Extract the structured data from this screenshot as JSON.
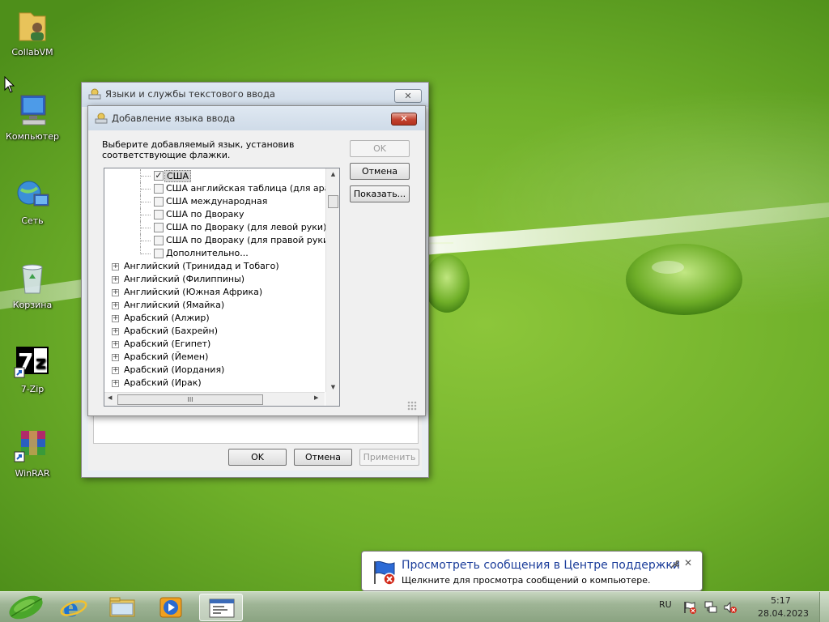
{
  "desktop": {
    "icons": [
      {
        "label": "CollabVM",
        "icon": "user-folder-icon"
      },
      {
        "label": "Компьютер",
        "icon": "computer-icon"
      },
      {
        "label": "Сеть",
        "icon": "network-icon"
      },
      {
        "label": "Корзина",
        "icon": "recycle-bin-icon"
      },
      {
        "label": "7-Zip",
        "icon": "7zip-icon"
      },
      {
        "label": "WinRAR",
        "icon": "winrar-icon"
      }
    ]
  },
  "outer_window": {
    "title": "Языки и службы текстового ввода",
    "close": "✕",
    "ok_label": "OK",
    "cancel_label": "Отмена",
    "apply_label": "Применить"
  },
  "add_dialog": {
    "title": "Добавление языка ввода",
    "close": "✕",
    "instruction": "Выберите добавляемый язык, установив соответствующие флажки.",
    "ok_label": "OK",
    "cancel_label": "Отмена",
    "show_label": "Показать...",
    "tree": {
      "sub_items": [
        {
          "label": "США",
          "checked": true,
          "selected": true
        },
        {
          "label": "США английская таблица (для арабской клавиатуры)",
          "checked": false
        },
        {
          "label": "США международная",
          "checked": false
        },
        {
          "label": "США по Двораку",
          "checked": false
        },
        {
          "label": "США по Двораку (для левой руки)",
          "checked": false
        },
        {
          "label": "США по Двораку (для правой руки)",
          "checked": false
        },
        {
          "label": "Дополнительно...",
          "checked": false
        }
      ],
      "languages": [
        "Английский (Тринидад и Тобаго)",
        "Английский (Филиппины)",
        "Английский (Южная Африка)",
        "Английский (Ямайка)",
        "Арабский (Алжир)",
        "Арабский (Бахрейн)",
        "Арабский (Египет)",
        "Арабский (Йемен)",
        "Арабский (Иордания)",
        "Арабский (Ирак)"
      ],
      "expander_symbol": "+",
      "hscroll_grip": "III"
    }
  },
  "notification": {
    "title": "Просмотреть сообщения в Центре поддержки",
    "text": "Щелкните для просмотра сообщений о компьютере.",
    "close": "✕"
  },
  "taskbar": {
    "language": "RU",
    "time": "5:17",
    "date": "28.04.2023"
  },
  "colors": {
    "link_blue": "#1b3d9a",
    "close_red": "#c2422f",
    "wallpaper_green": "#7dbd32"
  }
}
